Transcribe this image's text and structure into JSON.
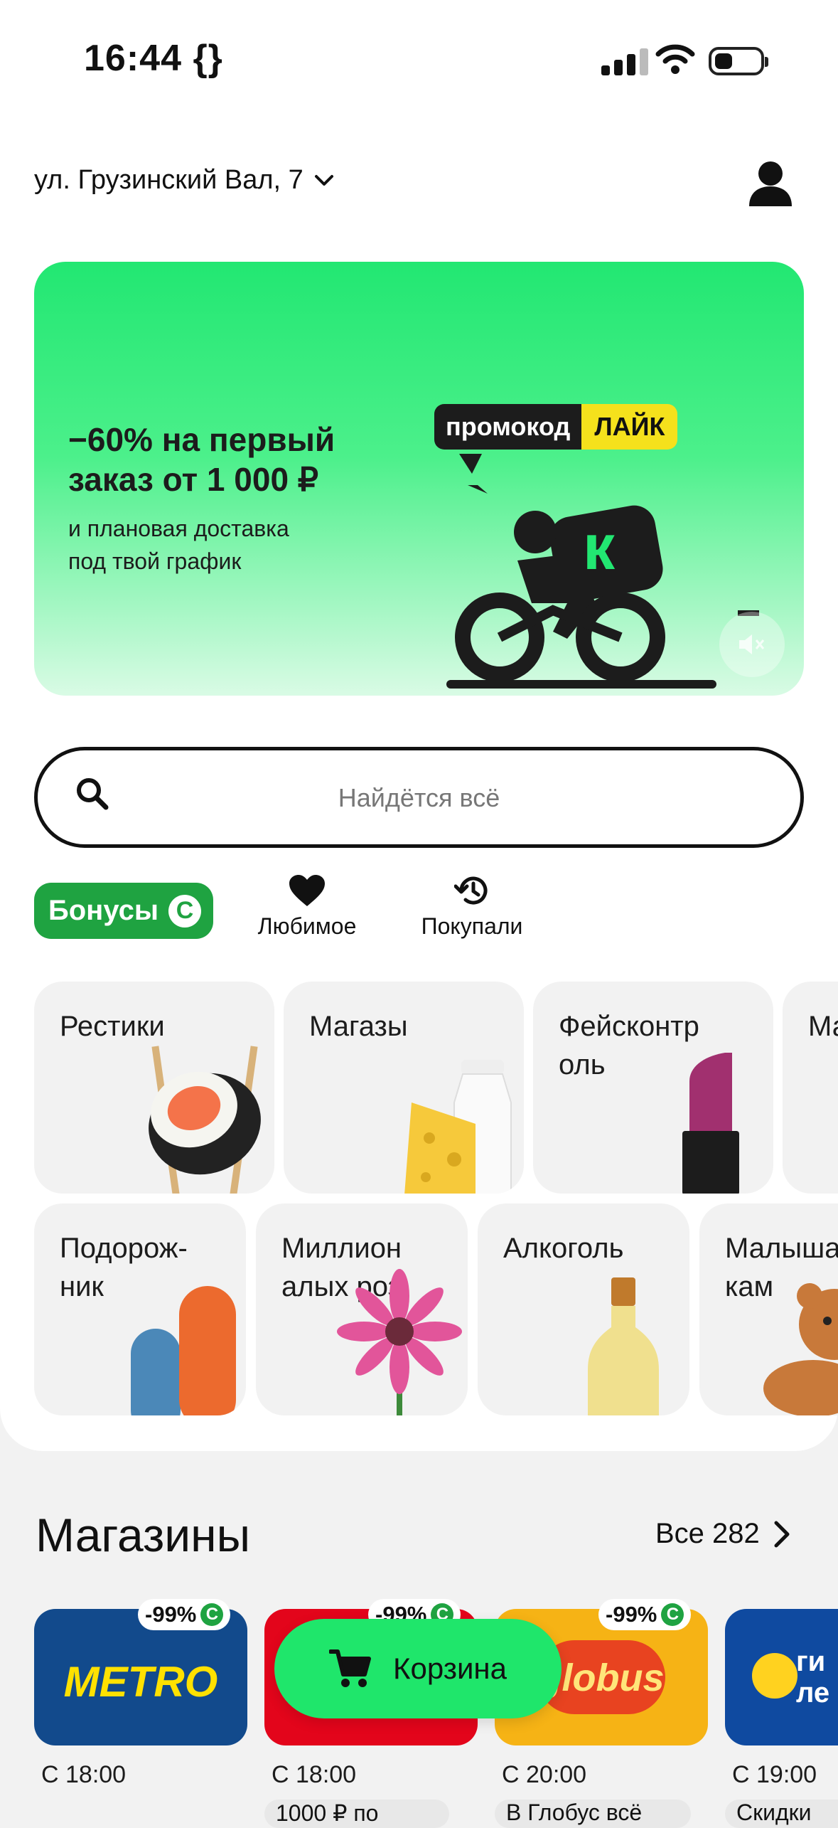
{
  "status_bar": {
    "time": "16:44 {}"
  },
  "header": {
    "address": "ул. Грузинский Вал, 7"
  },
  "banner": {
    "headline_line1": "−60% на первый",
    "headline_line2": "заказ от 1 000 ₽",
    "sub_line1": "и плановая доставка",
    "sub_line2": "под твой график",
    "promo_label": "промокод",
    "promo_code": "ЛАЙК"
  },
  "search": {
    "placeholder": "Найдётся всё"
  },
  "quick_actions": {
    "bonus": "Бонусы",
    "bonus_icon_letter": "С",
    "favorites": "Любимое",
    "purchased": "Покупали"
  },
  "categories_row1": [
    {
      "label": "Рестики"
    },
    {
      "label": "Магазы"
    },
    {
      "label": "Фейсконтр\nоль"
    },
    {
      "label": "Ма"
    }
  ],
  "categories_row2": [
    {
      "label": "Подорож-\nник"
    },
    {
      "label": "Миллион\nалых роз"
    },
    {
      "label": "Алкоголь"
    },
    {
      "label": "Малыша\nкам"
    }
  ],
  "stores": {
    "title": "Магазины",
    "all_label": "Все 282",
    "items": [
      {
        "name": "METRO",
        "discount": "-99%",
        "time": "С 18:00",
        "chip": ""
      },
      {
        "name": "",
        "discount": "-99%",
        "time": "С 18:00",
        "chip": "1000 ₽ по"
      },
      {
        "name": "globus",
        "discount": "-99%",
        "time": "С 20:00",
        "chip": "В Глобус всё"
      },
      {
        "name": "ги\nле",
        "discount": "",
        "time": "С 19:00",
        "chip": "Скидки"
      }
    ]
  },
  "cart": {
    "label": "Корзина"
  },
  "colors": {
    "accent_green": "#1fe66b",
    "bonus_green": "#1fa341",
    "promo_yellow": "#f5e11c"
  }
}
